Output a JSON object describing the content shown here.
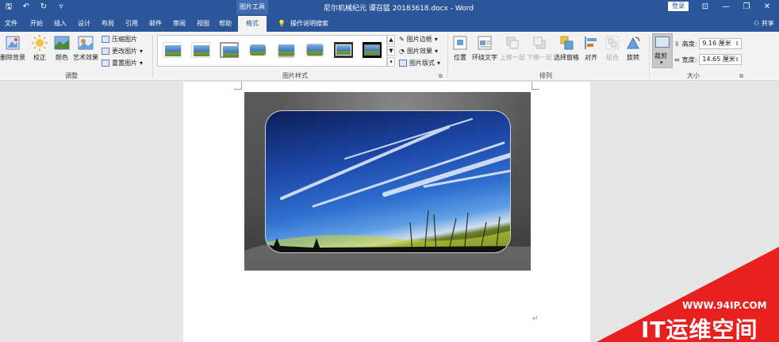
{
  "titlebar": {
    "context_tools": "图片工具",
    "document_title": "尼尔机械纪元 谭召猛 20183618.docx - Word",
    "login": "登录"
  },
  "tabs": [
    "文件",
    "开始",
    "插入",
    "设计",
    "布局",
    "引用",
    "邮件",
    "审阅",
    "视图",
    "帮助"
  ],
  "active_tab": "格式",
  "tell_me": "操作说明搜索",
  "share": "共享",
  "adjust_group": {
    "label": "调整",
    "remove_bg": "删除背景",
    "corrections": "校正",
    "color": "颜色",
    "artistic": "艺术效果",
    "compress": "压缩图片",
    "change": "更改图片",
    "reset": "重置图片"
  },
  "styles_group": {
    "label": "图片样式",
    "border": "图片边框",
    "effects": "图片效果",
    "layout": "图片版式"
  },
  "arrange_group": {
    "label": "排列",
    "position": "位置",
    "wrap": "环绕文字",
    "forward": "上移一层",
    "backward": "下移一层",
    "selection_pane": "选择窗格",
    "align": "对齐",
    "group": "组合",
    "rotate": "旋转"
  },
  "size_group": {
    "label": "大小",
    "crop": "裁剪",
    "height_label": "高度:",
    "height_value": "9.16 厘米",
    "width_label": "宽度:",
    "width_value": "14.65 厘米"
  },
  "watermark": {
    "url": "WWW.94IP.COM",
    "name": "IT运维空间"
  },
  "colors": {
    "word_blue": "#2b579a",
    "ribbon_bg": "#f3f3f3",
    "watermark_red": "#e8201f"
  }
}
